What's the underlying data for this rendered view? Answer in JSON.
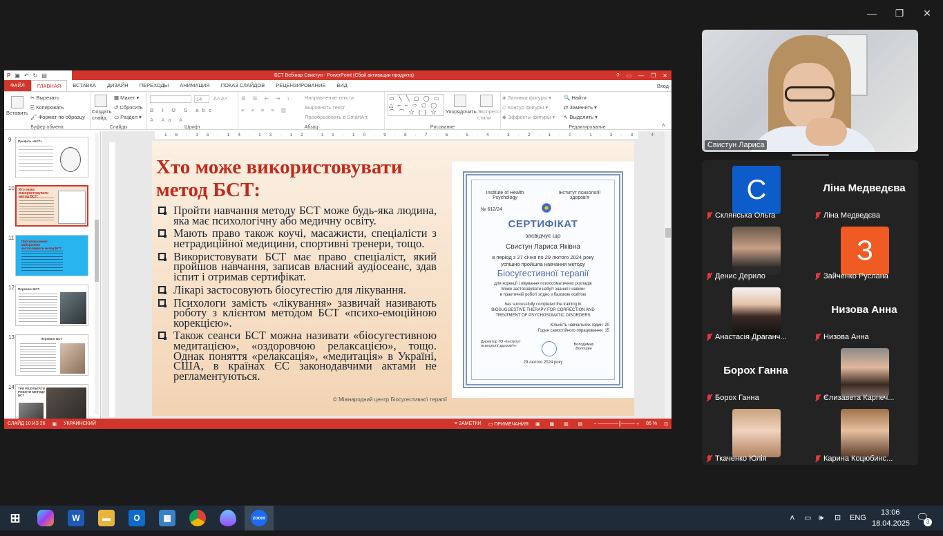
{
  "ppt": {
    "title": "БСТ Вебінар Свистун - PowerPoint (Сбой активации продукта)",
    "tabs": [
      "ФАЙЛ",
      "ГЛАВНАЯ",
      "ВСТАВКА",
      "ДИЗАЙН",
      "ПЕРЕХОДЫ",
      "АНИМАЦИЯ",
      "ПОКАЗ СЛАЙДОВ",
      "РЕЦЕНЗИРОВАНИЕ",
      "ВИД"
    ],
    "signin": "Вход",
    "ribbon": {
      "paste": "Вставить",
      "cut": "Вырезать",
      "copy": "Копировать",
      "format_painter": "Формат по образцу",
      "clipboard": "Буфер обмена",
      "new_slide": "Создать слайд",
      "layout": "Макет",
      "reset": "Сбросить",
      "section": "Раздел",
      "slides": "Слайды",
      "font_size": "14",
      "font": "Шрифт",
      "text_direction": "Направление текста",
      "align_text": "Выровнять текст",
      "smartart": "Преобразовать в SmartArt",
      "paragraph": "Абзац",
      "arrange": "Упорядочить",
      "quick_styles": "Экспресс-стили",
      "drawing": "Рисование",
      "shape_fill": "Заливка фигуры",
      "shape_outline": "Контур фигуры",
      "shape_effects": "Эффекты фигуры",
      "find": "Найти",
      "replace": "Заменить",
      "select": "Выделить",
      "editing": "Редактирование"
    },
    "thumbnails": [
      {
        "num": "9",
        "title": "Профіль «БСТ»"
      },
      {
        "num": "10",
        "title": "Хто може використовувати метод БСТ:"
      },
      {
        "num": "11",
        "title": "Протипоказання: Заборонено застосовувати метод БСТ"
      },
      {
        "num": "12",
        "title": "Переваги БСТ"
      },
      {
        "num": "13",
        "title": "Переваги БСТ"
      },
      {
        "num": "14",
        "title": "ТРИ РЕЗУЛЬТАТИ РОБОТИ МЕТОДУ БСТ"
      }
    ],
    "slide": {
      "title": "Хто може використовувати метод БСТ:",
      "bullets": [
        "Пройти навчання методу БСТ може будь-яка людина, яка має психологічну або медичну освіту.",
        "Мають право також коучі, масажисти, спеціалісти з нетрадиційної медицини, спортивні тренери, тощо.",
        "Використовувати БСТ має право спеціаліст, який пройшов навчання, записав власний аудіосеанс, здав іспит і отримав сертифікат.",
        "Лікарі застосовують біосугестію для лікування.",
        "Психологи замість «лікування» зазвичай називають роботу з клієнтом методом БСТ «психо-емоційною корекцією».",
        "Також сеанси БСТ можна називати «біосугестивною медитацією», «оздоровчою релаксацією», тощо. Однак поняття «релаксація», «медитація» в Україні, США, в країнах ЄС законодавчими актами не регламентуються."
      ],
      "footer": "© Міжнародний центр Біосугестивної терапії"
    },
    "certificate": {
      "org_en": "Institute of Health Psychology",
      "org_ua": "Інститут психології здоров'я",
      "number": "№ 612/24",
      "heading": "СЕРТИФІКАТ",
      "certifies": "засвідчує що",
      "name": "Свистун Лариса Яківна",
      "period": "в період з 27 січня по 29 лютого 2024 року",
      "completed": "успішно пройшла навчання методу",
      "course": "Біосугестивної терапії",
      "desc1": "для корекції і лікування психосоматичних розладів",
      "desc2": "Може застосовувати набуті знання і навики",
      "desc3": "в практичній роботі згідно з базовою освітою",
      "en1": "has successfully completed the training in",
      "en2": "BIOSUGGESTIVE THERAPY FOR CORRECTION AND",
      "en3": "TREATMENT OF PSYCHOSOMATIC DISORDERS",
      "hours1": "Кількість навчальних годин: 20",
      "hours2": "Годин самостійного опрацювання: 15",
      "director": "Директор ГО «Інститут психології здоров'я»",
      "signer": "Володимир Волошин",
      "date": "29 лютого 2024 року"
    },
    "status": {
      "slide": "СЛАЙД 10 ИЗ 26",
      "lang": "УКРАИНСКИЙ",
      "notes": "ЗАМЕТКИ",
      "comments": "ПРИМЕЧАНИЯ",
      "zoom": "86 %"
    }
  },
  "zoom": {
    "active_speaker": "Свистун Лариса",
    "participants": [
      {
        "name": "Склянська Ольга",
        "avatar_letter": "С",
        "avatar_color": "#0d5cc9"
      },
      {
        "name": "Ліна Медведєва",
        "display": "Ліна Медведєва"
      },
      {
        "name": "Денис Дерило"
      },
      {
        "name": "Зайченко Руслана",
        "avatar_letter": "З",
        "avatar_color": "#f05a23"
      },
      {
        "name": "Анастасія Драганч..."
      },
      {
        "name": "Низова Анна",
        "display": "Низова Анна"
      },
      {
        "name": "Борох Ганна",
        "display": "Борох Ганна"
      },
      {
        "name": "Єлизавета Карпеч..."
      },
      {
        "name": "Ткаченко Юлія"
      },
      {
        "name": "Карина Коцюбинс..."
      }
    ]
  },
  "taskbar": {
    "lang": "ENG",
    "time": "13:06",
    "date": "18.04.2025",
    "notifications": "3"
  }
}
